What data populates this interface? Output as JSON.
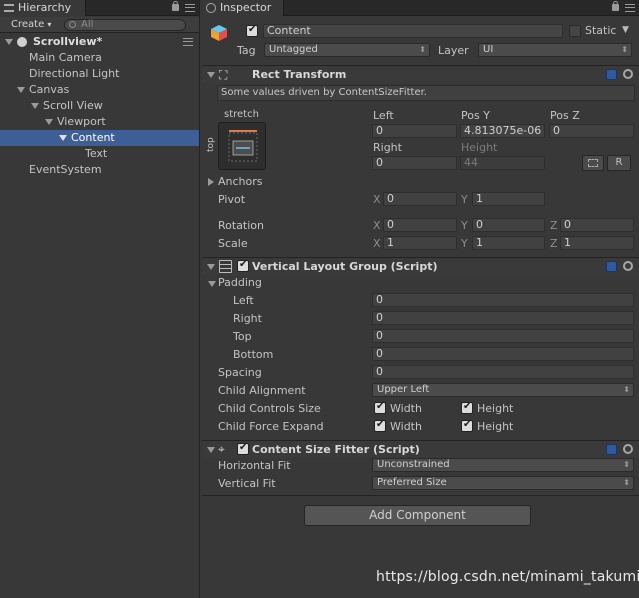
{
  "hierarchy": {
    "tab_label": "Hierarchy",
    "create_label": "Create",
    "search_placeholder": "All",
    "scene_name": "Scrollview*",
    "items": [
      "Main Camera",
      "Directional Light",
      "Canvas",
      "Scroll View",
      "Viewport",
      "Content",
      "Text",
      "EventSystem"
    ],
    "selected_item": "Content"
  },
  "inspector": {
    "tab_label": "Inspector",
    "object_name": "Content",
    "static_label": "Static",
    "tag_label": "Tag",
    "tag_value": "Untagged",
    "layer_label": "Layer",
    "layer_value": "UI",
    "rect_transform": {
      "title": "Rect Transform",
      "note": "Some values driven by ContentSizeFitter.",
      "anchor_h": "stretch",
      "anchor_v": "top",
      "col_left": "Left",
      "col_posy": "Pos Y",
      "col_posz": "Pos Z",
      "left_value": "0",
      "posy_value": "4.813075e-06",
      "posz_value": "0",
      "col_right": "Right",
      "col_height": "Height",
      "right_value": "0",
      "height_value": "44",
      "r_button": "R",
      "anchors_label": "Anchors",
      "pivot_label": "Pivot",
      "pivot_x": "0",
      "pivot_y": "1",
      "rotation_label": "Rotation",
      "rotation_x": "0",
      "rotation_y": "0",
      "rotation_z": "0",
      "scale_label": "Scale",
      "scale_x": "1",
      "scale_y": "1",
      "scale_z": "1",
      "x": "X",
      "y": "Y",
      "z": "Z"
    },
    "vertical_layout": {
      "title": "Vertical Layout Group (Script)",
      "padding_label": "Padding",
      "left_label": "Left",
      "left_value": "0",
      "right_label": "Right",
      "right_value": "0",
      "top_label": "Top",
      "top_value": "0",
      "bottom_label": "Bottom",
      "bottom_value": "0",
      "spacing_label": "Spacing",
      "spacing_value": "0",
      "child_alignment_label": "Child Alignment",
      "child_alignment_value": "Upper Left",
      "child_controls_label": "Child Controls Size",
      "child_force_label": "Child Force Expand",
      "width_label": "Width",
      "height_label": "Height"
    },
    "content_size_fitter": {
      "title": "Content Size Fitter (Script)",
      "horizontal_label": "Horizontal Fit",
      "horizontal_value": "Unconstrained",
      "vertical_label": "Vertical Fit",
      "vertical_value": "Preferred Size"
    },
    "add_component_label": "Add Component"
  },
  "watermark": "https://blog.csdn.net/minami_takumi"
}
